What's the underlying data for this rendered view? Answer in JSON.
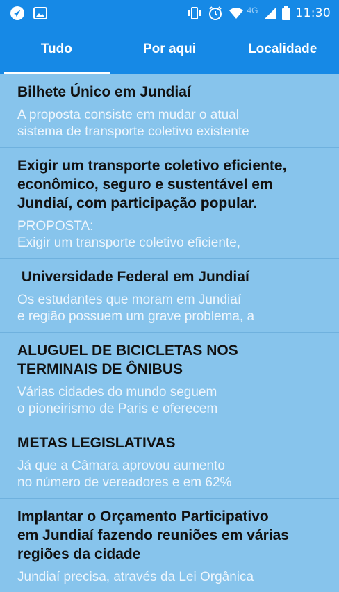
{
  "status": {
    "time": "11:30",
    "network": "4G",
    "icons": [
      "navigation-icon",
      "image-icon",
      "vibrate-icon",
      "alarm-icon",
      "wifi-icon",
      "signal-icon",
      "battery-icon"
    ]
  },
  "tabs": [
    {
      "label": "Tudo",
      "active": true
    },
    {
      "label": "Por aqui",
      "active": false
    },
    {
      "label": "Localidade",
      "active": false
    }
  ],
  "cards": [
    {
      "title": "Bilhete Único em Jundiaí",
      "body": "A proposta consiste em mudar o atual\nsistema de transporte coletivo existente"
    },
    {
      "title": "Exigir um transporte coletivo eficiente,\neconômico, seguro e sustentável em\nJundiaí, com participação popular.",
      "body": "PROPOSTA:\nExigir um transporte coletivo eficiente,"
    },
    {
      "title": " Universidade Federal em Jundiaí",
      "body": "Os estudantes que moram em Jundiaí\ne região possuem um grave problema, a"
    },
    {
      "title": "ALUGUEL DE BICICLETAS NOS\nTERMINAIS DE ÔNIBUS",
      "body": "Várias cidades do mundo seguem\no pioneirismo de Paris e oferecem"
    },
    {
      "title": "METAS LEGISLATIVAS",
      "body": "Já que a Câmara aprovou aumento\nno número de vereadores e em 62%"
    },
    {
      "title": "Implantar o Orçamento Participativo\nem Jundiaí fazendo reuniões em várias\nregiões da cidade",
      "body": "Jundiaí precisa, através da Lei Orgânica"
    }
  ],
  "colors": {
    "primary": "#1689e6",
    "list_background": "#87c4ec",
    "title_text": "#111111",
    "body_text": "#eef6fd"
  }
}
